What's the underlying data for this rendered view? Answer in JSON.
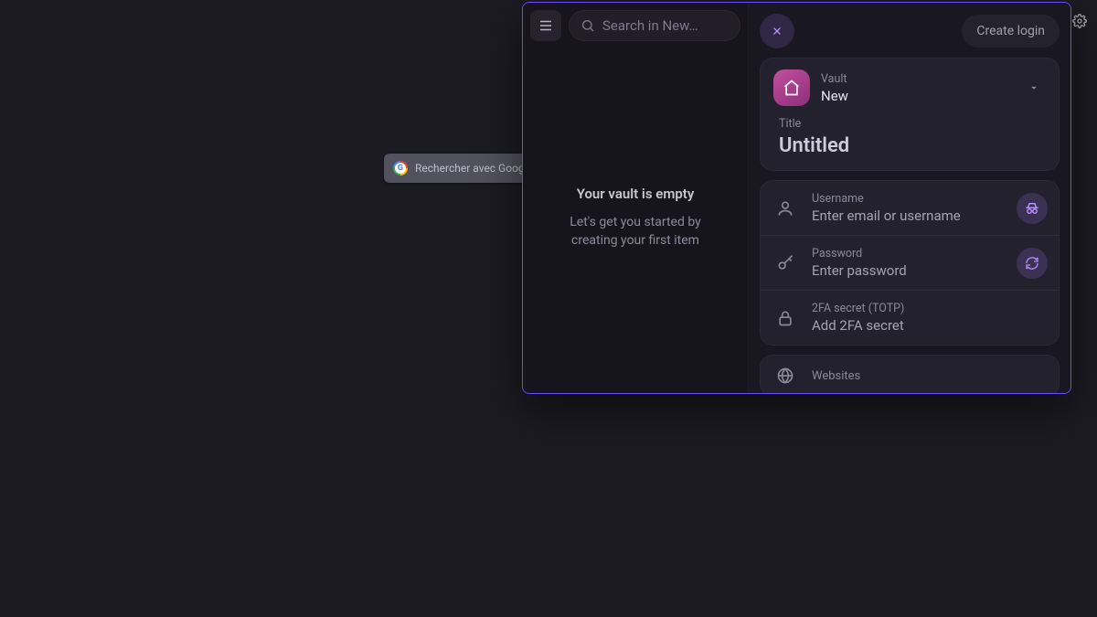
{
  "newtab": {
    "search_placeholder": "Rechercher avec Google ou saisir une adresse"
  },
  "panel": {
    "left": {
      "search_placeholder": "Search in New…",
      "empty_title": "Your vault is empty",
      "empty_sub_line1": "Let's get you started by",
      "empty_sub_line2": "creating your first item"
    },
    "right": {
      "create_button": "Create login",
      "vault_label": "Vault",
      "vault_name": "New",
      "title_label": "Title",
      "title_value": "Untitled",
      "username_label": "Username",
      "username_placeholder": "Enter email or username",
      "password_label": "Password",
      "password_placeholder": "Enter password",
      "totp_label": "2FA secret (TOTP)",
      "totp_placeholder": "Add 2FA secret",
      "websites_label": "Websites"
    }
  }
}
